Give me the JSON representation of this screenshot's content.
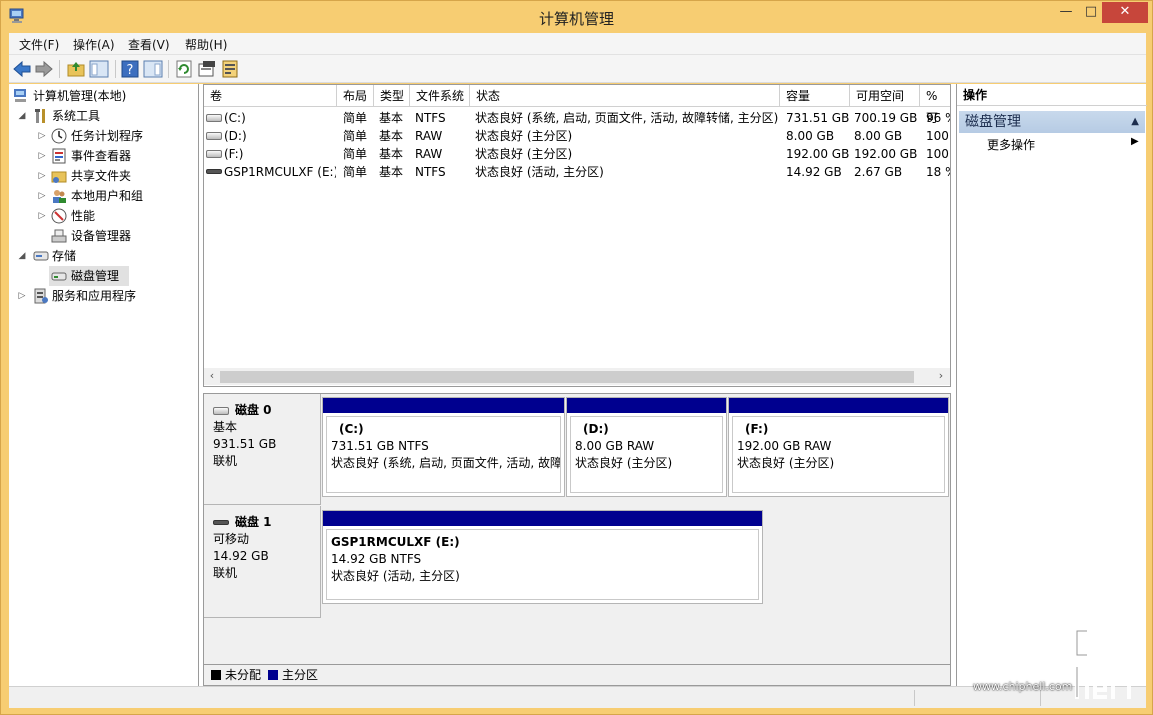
{
  "window": {
    "title": "计算机管理"
  },
  "menu": [
    "文件(F)",
    "操作(A)",
    "查看(V)",
    "帮助(H)"
  ],
  "tree": {
    "root": "计算机管理(本地)",
    "system_tools": "系统工具",
    "task_scheduler": "任务计划程序",
    "event_viewer": "事件查看器",
    "shared_folders": "共享文件夹",
    "local_users": "本地用户和组",
    "performance": "性能",
    "device_manager": "设备管理器",
    "storage": "存储",
    "disk_management": "磁盘管理",
    "services_apps": "服务和应用程序"
  },
  "volume_list": {
    "headers": [
      "卷",
      "布局",
      "类型",
      "文件系统",
      "状态",
      "容量",
      "可用空间",
      "% 可"
    ],
    "rows": [
      {
        "volume": "(C:)",
        "layout": "简单",
        "type": "基本",
        "fs": "NTFS",
        "status": "状态良好 (系统, 启动, 页面文件, 活动, 故障转储, 主分区)",
        "capacity": "731.51 GB",
        "free": "700.19 GB",
        "pct": "96 %"
      },
      {
        "volume": "(D:)",
        "layout": "简单",
        "type": "基本",
        "fs": "RAW",
        "status": "状态良好 (主分区)",
        "capacity": "8.00 GB",
        "free": "8.00 GB",
        "pct": "100"
      },
      {
        "volume": "(F:)",
        "layout": "简单",
        "type": "基本",
        "fs": "RAW",
        "status": "状态良好 (主分区)",
        "capacity": "192.00 GB",
        "free": "192.00 GB",
        "pct": "100"
      },
      {
        "volume": "GSP1RMCULXF (E:)",
        "layout": "简单",
        "type": "基本",
        "fs": "NTFS",
        "status": "状态良好 (活动, 主分区)",
        "capacity": "14.92 GB",
        "free": "2.67 GB",
        "pct": "18 %"
      }
    ]
  },
  "disks": [
    {
      "name": "磁盘 0",
      "kind": "基本",
      "size": "931.51 GB",
      "state": "联机",
      "partitions": [
        {
          "title": "(C:)",
          "size": "731.51 GB NTFS",
          "status": "状态良好 (系统, 启动, 页面文件, 活动, 故障"
        },
        {
          "title": "(D:)",
          "size": "8.00 GB RAW",
          "status": "状态良好 (主分区)"
        },
        {
          "title": "(F:)",
          "size": "192.00 GB RAW",
          "status": "状态良好 (主分区)"
        }
      ]
    },
    {
      "name": "磁盘 1",
      "kind": "可移动",
      "size": "14.92 GB",
      "state": "联机",
      "partitions": [
        {
          "title": "GSP1RMCULXF  (E:)",
          "size": "14.92 GB NTFS",
          "status": "状态良好 (活动, 主分区)"
        }
      ]
    }
  ],
  "legend": {
    "unallocated": "未分配",
    "primary": "主分区",
    "unallocated_color": "#000000",
    "primary_color": "#00008f"
  },
  "actions": {
    "header": "操作",
    "group": "磁盘管理",
    "more": "更多操作"
  },
  "watermark": {
    "url": "www.chiphell.com"
  },
  "colors": {
    "titlebar": "#f7cd72",
    "close": "#c7463b",
    "partition_bar": "#00008f",
    "action_group": "#b6cbe4"
  }
}
